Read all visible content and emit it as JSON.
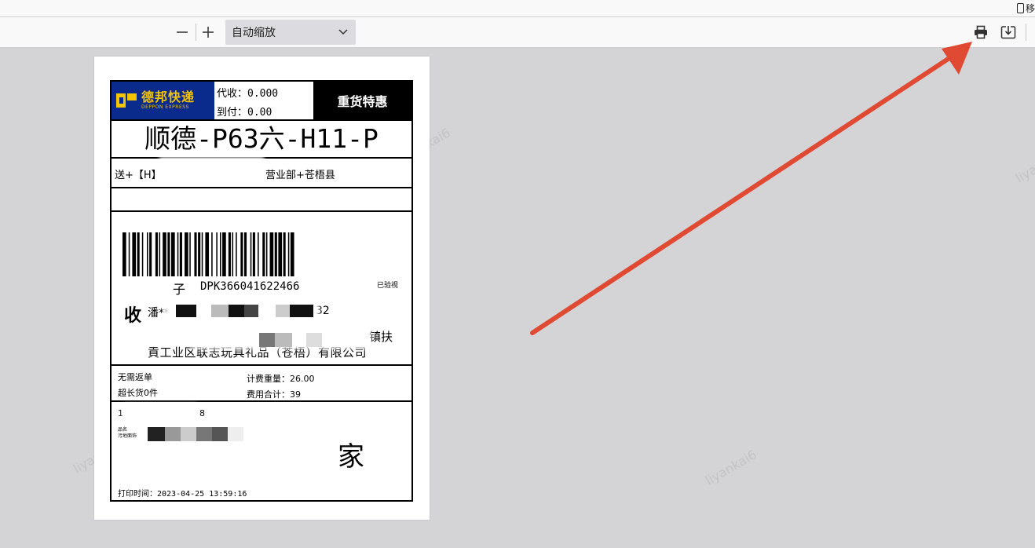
{
  "top_strip": {
    "mobile_label": "移"
  },
  "toolbar": {
    "zoom_out_glyph": "—",
    "zoom_in_glyph": "+",
    "zoom_select_value": "自动缩放",
    "print_icon": "print-icon",
    "download_icon": "download-icon"
  },
  "watermark": {
    "text": "liyankai6"
  },
  "label": {
    "logo_cn": "德邦快递",
    "logo_en": "DEPPON EXPRESS",
    "cod_line1": "代收：0.000",
    "cod_line2": "到付：0.00",
    "service": "重货特惠",
    "route": "顺德-P63六-H11-P",
    "dest_left": "送+【H】",
    "dest_right": "营业部+苍梧县",
    "barcode_prefix": "子",
    "barcode_number": "DPK366041622466",
    "verified": "已验视",
    "recv_mark": "收",
    "recv_name": "潘**",
    "recv_phone_tail": "32",
    "recv_addr1": "镇扶",
    "recv_addr2": "貢工业区联志玩具礼品（苍梧）有限公司",
    "info_tl": "无需返单",
    "info_bl": "超长货0件",
    "info_tr": "计费重量：26.00",
    "info_br": "费用合计：39",
    "goods_prefix": "1",
    "goods_tail": "8",
    "goods_small1": "品名",
    "goods_small2": "污地面饰",
    "goods_small3": "",
    "home_char": "家",
    "print_time": "打印时间：2023-04-25 13:59:16"
  },
  "colors": {
    "viewer_bg": "#d4d4d7",
    "toolbar_bg": "#f9f9fa",
    "arrow": "#e04a32",
    "logo_bg": "#0a2a8c",
    "logo_fg": "#f5c400"
  }
}
